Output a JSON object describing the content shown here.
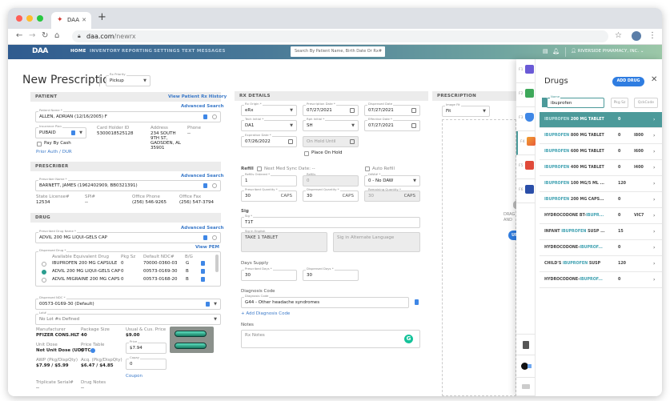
{
  "browser": {
    "tab_title": "DAA",
    "url_host": "daa.com",
    "url_path": "/newrx"
  },
  "appbar": {
    "logo": "DAA",
    "menu": [
      "HOME",
      "INVENTORY",
      "REPORTING",
      "SETTINGS",
      "TEXT MESSAGES"
    ],
    "search_placeholder": "Search By Patient Name, Birth Date Or Rx#",
    "user": "RIVERSIDE PHARMACY, INC."
  },
  "page": {
    "title": "New Prescription",
    "rx_priority": {
      "label": "Rx Priority",
      "value": "Pickup"
    }
  },
  "patient": {
    "section": "PATIENT",
    "history_link": "View Patient Rx History",
    "advanced_search": "Advanced Search",
    "name_label": "Patient Name *",
    "name_value": "ALLEN, ADRIAN  (12/16/2005) F",
    "insurance_label": "Insurance Plan",
    "insurance_value": "PUBAID",
    "card_holder_label": "Card Holder ID",
    "card_holder_value": "5300018525128",
    "address_label": "Address",
    "address_lines": [
      "234 SOUTH",
      "9TH ST,",
      "GADSDEN, AL",
      "35901"
    ],
    "phone_label": "Phone",
    "phone_value": "--",
    "pay_by_cash": "Pay By Cash",
    "prior_auth": "Prior Auth / DUR"
  },
  "prescriber": {
    "section": "PRESCRIBER",
    "advanced_search": "Advanced Search",
    "name_label": "Prescriber Name *",
    "name_value": "BARNETT, JAMES  (1962402909, BB0321391)",
    "state_license_label": "State License#",
    "state_license_value": "12534",
    "spi_label": "SPI#",
    "spi_value": "--",
    "office_phone_label": "Office Phone",
    "office_phone_value": "(256) 546-9265",
    "office_fax_label": "Office Fax",
    "office_fax_value": "(256) 547-3794"
  },
  "drug": {
    "section": "DRUG",
    "advanced_search": "Advanced Search",
    "prescribed_label": "Prescribed Drug Name *",
    "prescribed_value": "ADVIL 200 MG LIQUI-GELS CAP",
    "view_pem": "View PEM",
    "dispensed_label": "Dispensed Drug *",
    "equiv_headers": [
      "Available Equivalent Drug",
      "Pkg Sz",
      "Default NDC#",
      "B/G"
    ],
    "equiv_rows": [
      {
        "name": "IBUPROFEN 200 MG CAPSULE",
        "pkg": "0",
        "ndc": "70000-0360-03",
        "bg": "G",
        "selected": false
      },
      {
        "name": "ADVIL 200 MG LIQUI-GELS CAP",
        "pkg": "0",
        "ndc": "00573-0169-30",
        "bg": "B",
        "selected": true
      },
      {
        "name": "ADVIL MIGRAINE 200 MG CAPS",
        "pkg": "0",
        "ndc": "00573-0168-20",
        "bg": "B",
        "selected": false
      }
    ],
    "dispensed_ndc_label": "Dispensed NDC *",
    "dispensed_ndc_value": "00573-0169-30 (Default)",
    "lot_label": "Lot#",
    "lot_value": "No Lot #s Defined",
    "manufacturer_label": "Manufacturer",
    "manufacturer_value": "PFIZER CONS.HLT",
    "package_size_label": "Package Size",
    "package_size_value": "40",
    "usual_price_label": "Usual & Cus. Price",
    "usual_price_value": "$9.00",
    "unit_dose_label": "Unit Dose",
    "unit_dose_value": "Not Unit Dose (UD)",
    "price_table_label": "Price Table",
    "price_table_value": "OTC",
    "price_label": "Price",
    "price_value": "$7.94",
    "awp_label": "AWP (Pkg/DispQty)",
    "awp_value": "$7.99 / $5.99",
    "acq_label": "Acq. (Pkg/DispQty)",
    "acq_value": "$6.47 / $4.85",
    "copay_label": "Copay",
    "copay_value": "0",
    "coupon": "Coupon",
    "triplicate_label": "Triplicate Serial#",
    "triplicate_value": "--",
    "drug_notes_label": "Drug Notes",
    "drug_notes_value": "--"
  },
  "rx_details": {
    "section": "RX DETAILS",
    "rx_origin": {
      "label": "Rx Origin *",
      "value": "eRx"
    },
    "prescription_date": {
      "label": "Prescription Date *",
      "value": "07/27/2021"
    },
    "dispensed_date": {
      "label": "Dispensed Date",
      "value": "07/27/2021"
    },
    "tech_initial": {
      "label": "Tech Initial *",
      "value": "DA1"
    },
    "rph_initial": {
      "label": "Rph Initial *",
      "value": "SH"
    },
    "effective_date": {
      "label": "Effective Date *",
      "value": "07/27/2021"
    },
    "expiration_date": {
      "label": "Expiration Date *",
      "value": "07/26/2022"
    },
    "on_hold_until": "On Hold Until",
    "place_on_hold": "Place On Hold",
    "refill_title": "Refill",
    "next_med_sync": "Next Med Sync Date: --",
    "auto_refill": "Auto Refill",
    "refills_ordered": {
      "label": "Refills Ordered *",
      "value": "1"
    },
    "refills": {
      "label": "Refills",
      "value": "0"
    },
    "daw": {
      "label": "DAW# *",
      "value": "0 - No DAW"
    },
    "prescribed_qty": {
      "label": "Prescribed Quantity *",
      "value": "30",
      "unit": "CAPS"
    },
    "dispensed_qty": {
      "label": "Dispensed Quantity *",
      "value": "30",
      "unit": "CAPS"
    },
    "remaining_qty": {
      "label": "Remaining Quantity *",
      "value": "30",
      "unit": "CAPS"
    },
    "sig_title": "Sig",
    "sig": {
      "label": "Sig *",
      "value": "T1T"
    },
    "sig_english": {
      "label": "Sig in English",
      "value": "TAKE 1 TABLET"
    },
    "sig_alt_placeholder": "Sig in Alternate Language",
    "days_supply_title": "Days Supply",
    "prescribed_days": {
      "label": "Prescribed Days *",
      "value": "30"
    },
    "dispensed_days": {
      "label": "Dispensed Days *",
      "value": "30"
    },
    "diagnosis_title": "Diagnosis Code",
    "diagnosis": {
      "label": "Diagnosis Code",
      "value": "G44 - Other headache syndromes"
    },
    "add_diagnosis": "+ Add Diagnosis Code",
    "notes_title": "Notes",
    "notes_placeholder": "Rx Notes"
  },
  "prescription": {
    "section": "PRESCRIPTION",
    "image_fit": {
      "label": "Image Fit",
      "value": "Fit"
    },
    "drag_text": "DRAG AND",
    "upload": "UP"
  },
  "drugs_panel": {
    "title": "Drugs",
    "add_button": "ADD DRUG",
    "name_label": "Name",
    "name_value": "ibuprofen",
    "pkg_placeholder": "Pkg Sz",
    "qck_placeholder": "QckCode",
    "fkeys": [
      "F1",
      "F2",
      "F3",
      "F4",
      "F5",
      "F6"
    ],
    "rows": [
      {
        "pre": "",
        "hl": "IBUPROFEN",
        "post": " 200 MG TABLET",
        "qty": "0",
        "code": "",
        "selected": true
      },
      {
        "pre": "",
        "hl": "IBUPROFEN",
        "post": " 800 MG TABLET",
        "qty": "0",
        "code": "I800",
        "selected": false
      },
      {
        "pre": "",
        "hl": "IBUPROFEN",
        "post": " 600 MG TABLET",
        "qty": "0",
        "code": "I600",
        "selected": false
      },
      {
        "pre": "",
        "hl": "IBUPROFEN",
        "post": " 400 MG TABLET",
        "qty": "0",
        "code": "I400",
        "selected": false
      },
      {
        "pre": "",
        "hl": "IBUPROFEN",
        "post": " 100 MG/5 ML ...",
        "qty": "120",
        "code": "",
        "selected": false
      },
      {
        "pre": "",
        "hl": "IBUPROFEN",
        "post": " 200 MG CAPS...",
        "qty": "0",
        "code": "",
        "selected": false
      },
      {
        "pre": "HYDROCODONE BT-",
        "hl": "IBUPR...",
        "post": "",
        "qty": "0",
        "code": "VIC7",
        "selected": false
      },
      {
        "pre": "INFANT ",
        "hl": "IBUPROFEN",
        "post": " SUSP ...",
        "qty": "15",
        "code": "",
        "selected": false
      },
      {
        "pre": "HYDROCODONE-",
        "hl": "IBUPROF...",
        "post": "",
        "qty": "0",
        "code": "",
        "selected": false
      },
      {
        "pre": "CHILD'S ",
        "hl": "IBUPROFEN",
        "post": " SUSP",
        "qty": "120",
        "code": "",
        "selected": false
      },
      {
        "pre": "HYDROCODONE-",
        "hl": "IBUPROF...",
        "post": "",
        "qty": "0",
        "code": "",
        "selected": false
      }
    ]
  }
}
